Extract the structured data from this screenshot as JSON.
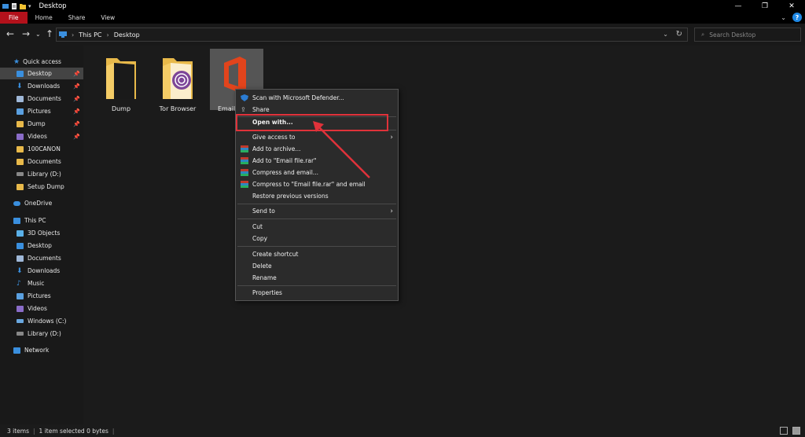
{
  "window": {
    "title": "Desktop"
  },
  "ribbon": {
    "tabs": [
      "File",
      "Home",
      "Share",
      "View"
    ]
  },
  "address": {
    "crumbs": [
      "This PC",
      "Desktop"
    ],
    "search_placeholder": "Search Desktop"
  },
  "sidebar": {
    "quick_access": "Quick access",
    "quick_items": [
      {
        "label": "Desktop",
        "icon": "desktop-icon",
        "pinned": true,
        "selected": true
      },
      {
        "label": "Downloads",
        "icon": "download-icon",
        "pinned": true
      },
      {
        "label": "Documents",
        "icon": "documents-icon",
        "pinned": true
      },
      {
        "label": "Pictures",
        "icon": "pictures-icon",
        "pinned": true
      },
      {
        "label": "Dump",
        "icon": "folder-icon",
        "pinned": true
      },
      {
        "label": "Videos",
        "icon": "videos-icon",
        "pinned": true
      },
      {
        "label": "100CANON",
        "icon": "folder-icon"
      },
      {
        "label": "Documents",
        "icon": "folder-icon"
      },
      {
        "label": "Library (D:)",
        "icon": "drive-icon"
      },
      {
        "label": "Setup Dump",
        "icon": "folder-icon"
      }
    ],
    "onedrive": "OneDrive",
    "this_pc": "This PC",
    "pc_items": [
      {
        "label": "3D Objects",
        "icon": "3d-objects-icon"
      },
      {
        "label": "Desktop",
        "icon": "desktop-icon"
      },
      {
        "label": "Documents",
        "icon": "documents-icon"
      },
      {
        "label": "Downloads",
        "icon": "download-icon"
      },
      {
        "label": "Music",
        "icon": "music-icon"
      },
      {
        "label": "Pictures",
        "icon": "pictures-icon"
      },
      {
        "label": "Videos",
        "icon": "videos-icon"
      },
      {
        "label": "Windows (C:)",
        "icon": "drive-icon"
      },
      {
        "label": "Library (D:)",
        "icon": "drive-icon"
      }
    ],
    "network": "Network"
  },
  "files": [
    {
      "label": "Dump",
      "icon": "folder-icon"
    },
    {
      "label": "Tor Browser",
      "icon": "tor-folder-icon"
    },
    {
      "label": "Email",
      "icon": "office-icon",
      "selected": true
    }
  ],
  "context_menu": {
    "items": [
      {
        "label": "Scan with Microsoft Defender...",
        "icon": "defender-icon"
      },
      {
        "label": "Share",
        "icon": "share-icon"
      },
      {
        "label": "Open with...",
        "bold": true
      },
      {
        "label": "Give access to",
        "submenu": true
      },
      {
        "label": "Add to archive...",
        "icon": "winrar-icon"
      },
      {
        "label": "Add to \"Email file.rar\"",
        "icon": "winrar-icon"
      },
      {
        "label": "Compress and email...",
        "icon": "winrar-icon"
      },
      {
        "label": "Compress to \"Email file.rar\" and email",
        "icon": "winrar-icon"
      },
      {
        "label": "Restore previous versions"
      },
      {
        "label": "Send to",
        "submenu": true
      },
      {
        "label": "Cut"
      },
      {
        "label": "Copy"
      },
      {
        "label": "Create shortcut"
      },
      {
        "label": "Delete"
      },
      {
        "label": "Rename"
      },
      {
        "label": "Properties"
      }
    ]
  },
  "status": {
    "count": "3 items",
    "selection": "1 item selected  0 bytes"
  },
  "colors": {
    "file_tab": "#b3111b",
    "highlight": "#e0323a",
    "background": "#191919"
  }
}
